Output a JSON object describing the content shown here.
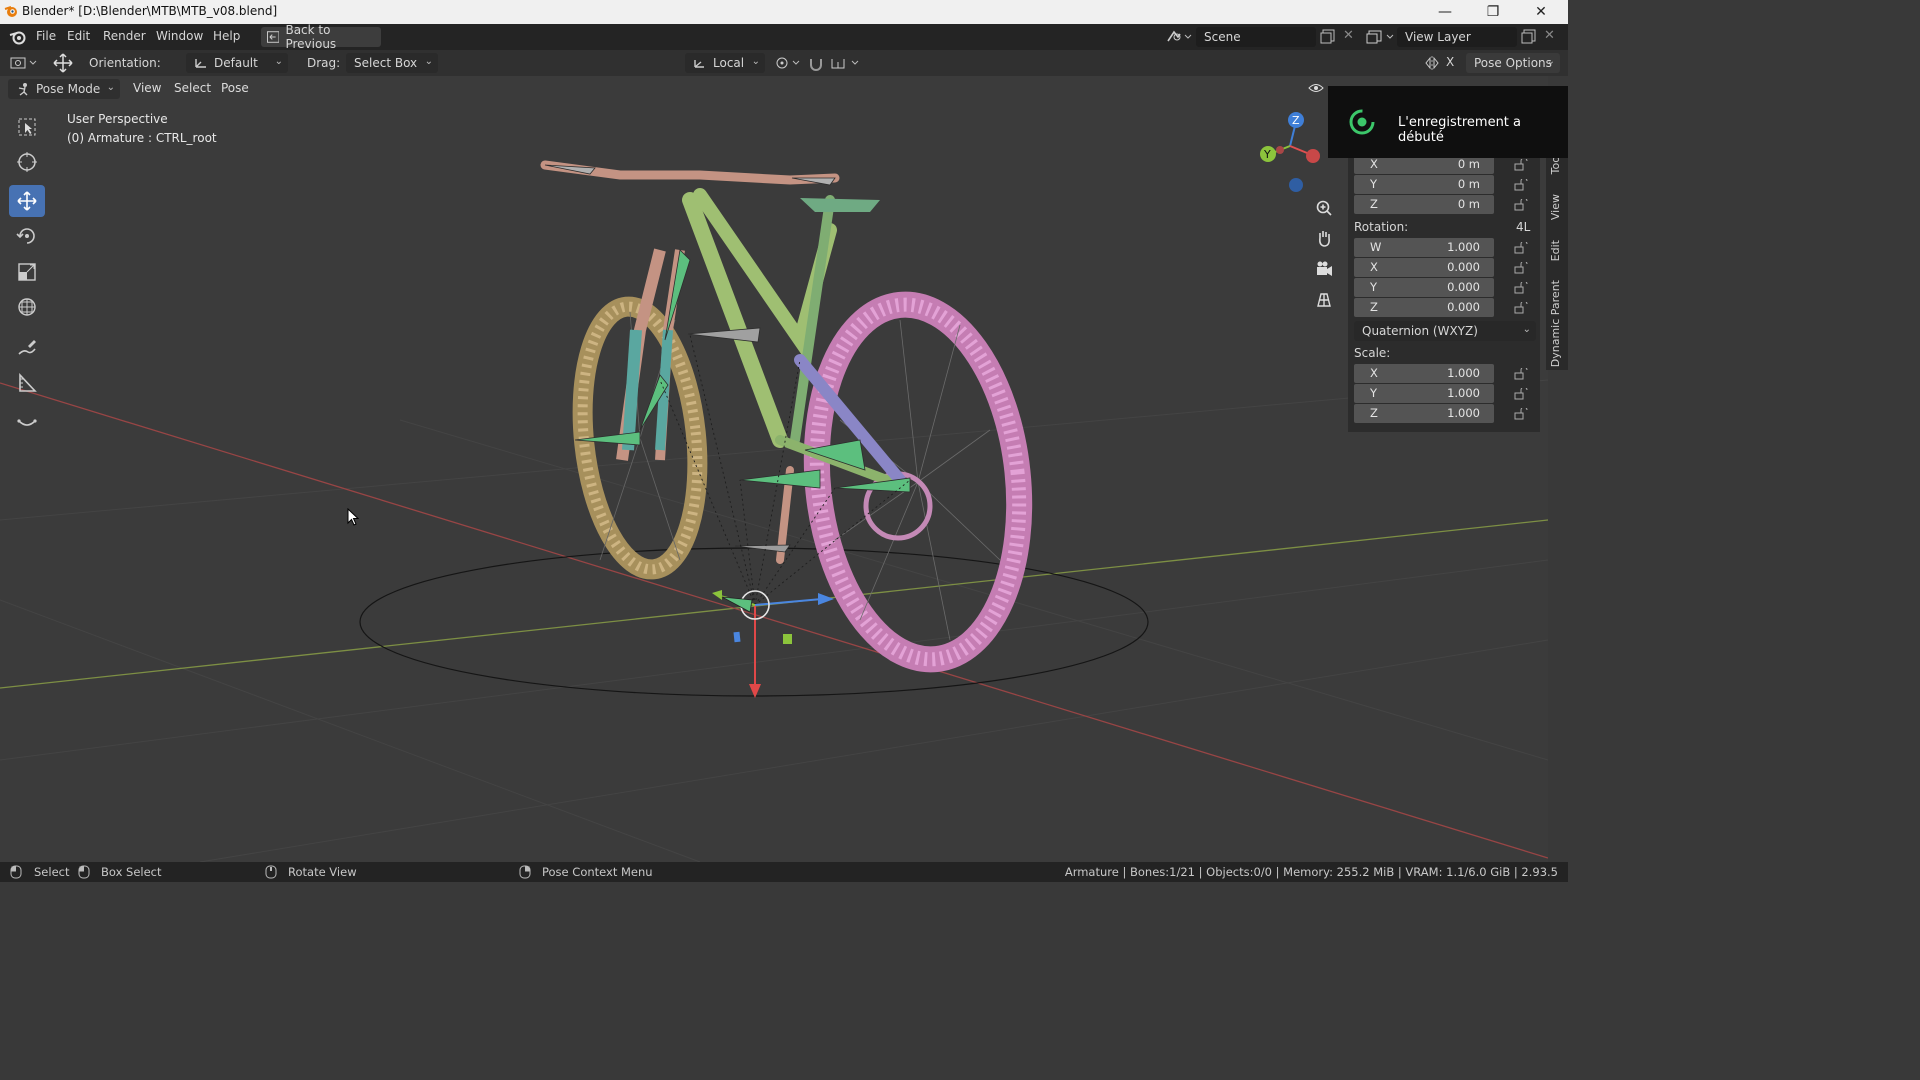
{
  "window": {
    "title": "Blender* [D:\\Blender\\MTB\\MTB_v08.blend]",
    "minimize_icon": "minimize-icon",
    "restore_icon": "restore-icon",
    "close_icon": "close-icon"
  },
  "menubar": {
    "items": [
      "File",
      "Edit",
      "Render",
      "Window",
      "Help"
    ],
    "back_button": "Back to Previous",
    "scene_label": "Scene",
    "view_layer_label": "View Layer"
  },
  "toolheader": {
    "orientation_label": "Orientation:",
    "orientation_value": "Default",
    "drag_label": "Drag:",
    "drag_value": "Select Box",
    "pivot_value": "Local",
    "pose_options": "Pose Options",
    "x_toggle": "X"
  },
  "viewport_header": {
    "mode": "Pose Mode",
    "menus": [
      "View",
      "Select",
      "Pose"
    ]
  },
  "viewport": {
    "perspective": "User Perspective",
    "active_object": "(0) Armature : CTRL_root",
    "gizmo_axes": [
      "Z",
      "Y"
    ]
  },
  "notification": {
    "text": "L'enregistrement a débuté"
  },
  "npanel": {
    "location": [
      {
        "axis": "X",
        "value": "0 m"
      },
      {
        "axis": "Y",
        "value": "0 m"
      },
      {
        "axis": "Z",
        "value": "0 m"
      }
    ],
    "rotation_label": "Rotation:",
    "rotation_mode_short": "4L",
    "rotation": [
      {
        "axis": "W",
        "value": "1.000"
      },
      {
        "axis": "X",
        "value": "0.000"
      },
      {
        "axis": "Y",
        "value": "0.000"
      },
      {
        "axis": "Z",
        "value": "0.000"
      }
    ],
    "rotation_mode": "Quaternion (WXYZ)",
    "scale_label": "Scale:",
    "scale": [
      {
        "axis": "X",
        "value": "1.000"
      },
      {
        "axis": "Y",
        "value": "1.000"
      },
      {
        "axis": "Z",
        "value": "1.000"
      }
    ],
    "tabs": [
      "Too",
      "View",
      "Edit",
      "Dynamic Parent"
    ]
  },
  "statusbar": {
    "select": "Select",
    "box_select": "Box Select",
    "rotate_view": "Rotate View",
    "context_menu": "Pose Context Menu",
    "stats": "Armature | Bones:1/21 | Objects:0/0 | Memory: 255.2 MiB | VRAM: 1.1/6.0 GiB | 2.93.5"
  },
  "colors": {
    "accent": "#4772b3",
    "axis_x": "#e05050",
    "axis_y": "#8cc43c",
    "axis_z": "#3f7fd8",
    "frame": "#9bc47a",
    "rear_wheel": "#d48bc4",
    "front_wheel": "#c9b07c"
  }
}
